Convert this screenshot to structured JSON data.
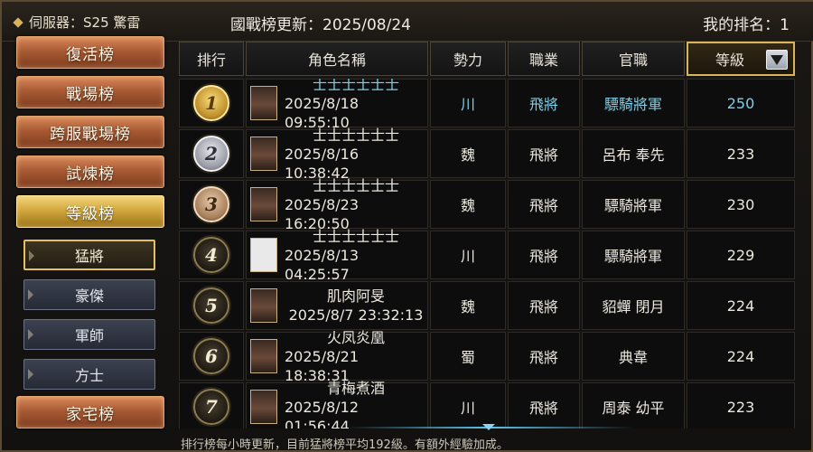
{
  "topbar": {
    "server": "伺服器：S25 驚雷",
    "update": "國戰榜更新：2025/08/24",
    "my_rank": "我的排名：1"
  },
  "menu": {
    "categories": [
      "復活榜",
      "戰場榜",
      "跨服戰場榜",
      "試煉榜",
      "等級榜",
      "家宅榜"
    ],
    "active_category": "等級榜",
    "sub_items": [
      "猛將",
      "豪傑",
      "軍師",
      "方士"
    ],
    "active_sub": "猛將"
  },
  "table": {
    "headers": [
      "排行",
      "角色名稱",
      "勢力",
      "職業",
      "官職",
      "等級"
    ],
    "sort_column": "等級",
    "rows": [
      {
        "rank": "1",
        "name": "士士士士士士",
        "time": "2025/8/18 09:55:10",
        "faction": "川",
        "job": "飛將",
        "title": "驃騎將軍",
        "level": "250"
      },
      {
        "rank": "2",
        "name": "士士士士士士",
        "time": "2025/8/16 10:38:42",
        "faction": "魏",
        "job": "飛將",
        "title": "呂布 奉先",
        "level": "233"
      },
      {
        "rank": "3",
        "name": "士士士士士士",
        "time": "2025/8/23 16:20:50",
        "faction": "魏",
        "job": "飛將",
        "title": "驃騎將軍",
        "level": "230"
      },
      {
        "rank": "4",
        "name": "士士士士士士",
        "time": "2025/8/13 04:25:57",
        "faction": "川",
        "job": "飛將",
        "title": "驃騎將軍",
        "level": "229"
      },
      {
        "rank": "5",
        "name": "肌肉阿旻",
        "time": "2025/8/7 23:32:13",
        "faction": "魏",
        "job": "飛將",
        "title": "貂蟬 閉月",
        "level": "224"
      },
      {
        "rank": "6",
        "name": "火凤炎凰",
        "time": "2025/8/21 18:38:31",
        "faction": "蜀",
        "job": "飛將",
        "title": "典韋",
        "level": "224"
      },
      {
        "rank": "7",
        "name": "青梅煮酒",
        "time": "2025/8/12 01:56:44",
        "faction": "川",
        "job": "飛將",
        "title": "周泰 幼平",
        "level": "223"
      }
    ]
  },
  "footer": "排行榜每小時更新，目前猛將榜平均192級。有額外經驗加成。",
  "colors": {
    "highlight_text": "#7ecfe8",
    "gold_border": "#d8b55a",
    "category_bg": "#a85a34",
    "active_category_bg": "#d4a840"
  }
}
